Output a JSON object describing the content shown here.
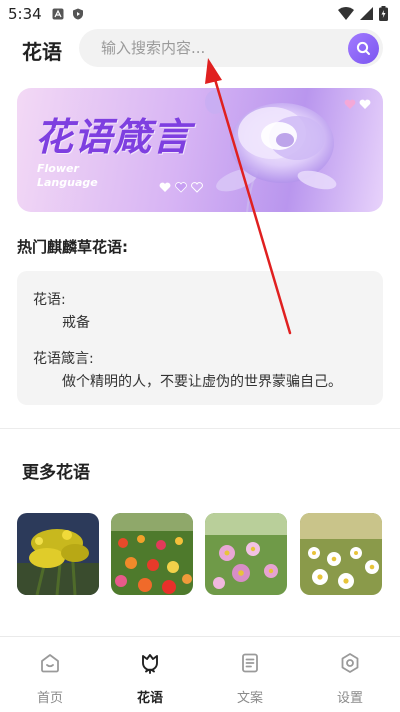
{
  "status_bar": {
    "time": "5:34",
    "icons_left": [
      "a-notification-icon",
      "shield-play-icon"
    ],
    "icons_right": [
      "wifi-icon",
      "signal-icon",
      "battery-icon"
    ]
  },
  "header": {
    "title": "花语",
    "search_placeholder": "输入搜索内容..."
  },
  "banner": {
    "title": "花语箴言",
    "subtitle_line1": "Flower",
    "subtitle_line2": "Language"
  },
  "hot_section": {
    "title": "热门麒麟草花语:",
    "meaning_label": "花语:",
    "meaning_value": "戒备",
    "quote_label": "花语箴言:",
    "quote_value": "做个精明的人，不要让虚伪的世界蒙骗自己。"
  },
  "more_section": {
    "title": "更多花语",
    "thumbnails": [
      {
        "name": "goldenrod-thumbnail"
      },
      {
        "name": "zinnia-field-thumbnail"
      },
      {
        "name": "cosmos-thumbnail"
      },
      {
        "name": "daisy-field-thumbnail"
      }
    ]
  },
  "bottom_nav": {
    "items": [
      {
        "label": "首页",
        "icon": "home-icon",
        "active": false
      },
      {
        "label": "花语",
        "icon": "flower-icon",
        "active": true
      },
      {
        "label": "文案",
        "icon": "document-icon",
        "active": false
      },
      {
        "label": "设置",
        "icon": "settings-icon",
        "active": false
      }
    ]
  },
  "colors": {
    "accent": "#7b55f0",
    "banner_title": "#7e3fe0",
    "annotation_arrow": "#e02020"
  }
}
